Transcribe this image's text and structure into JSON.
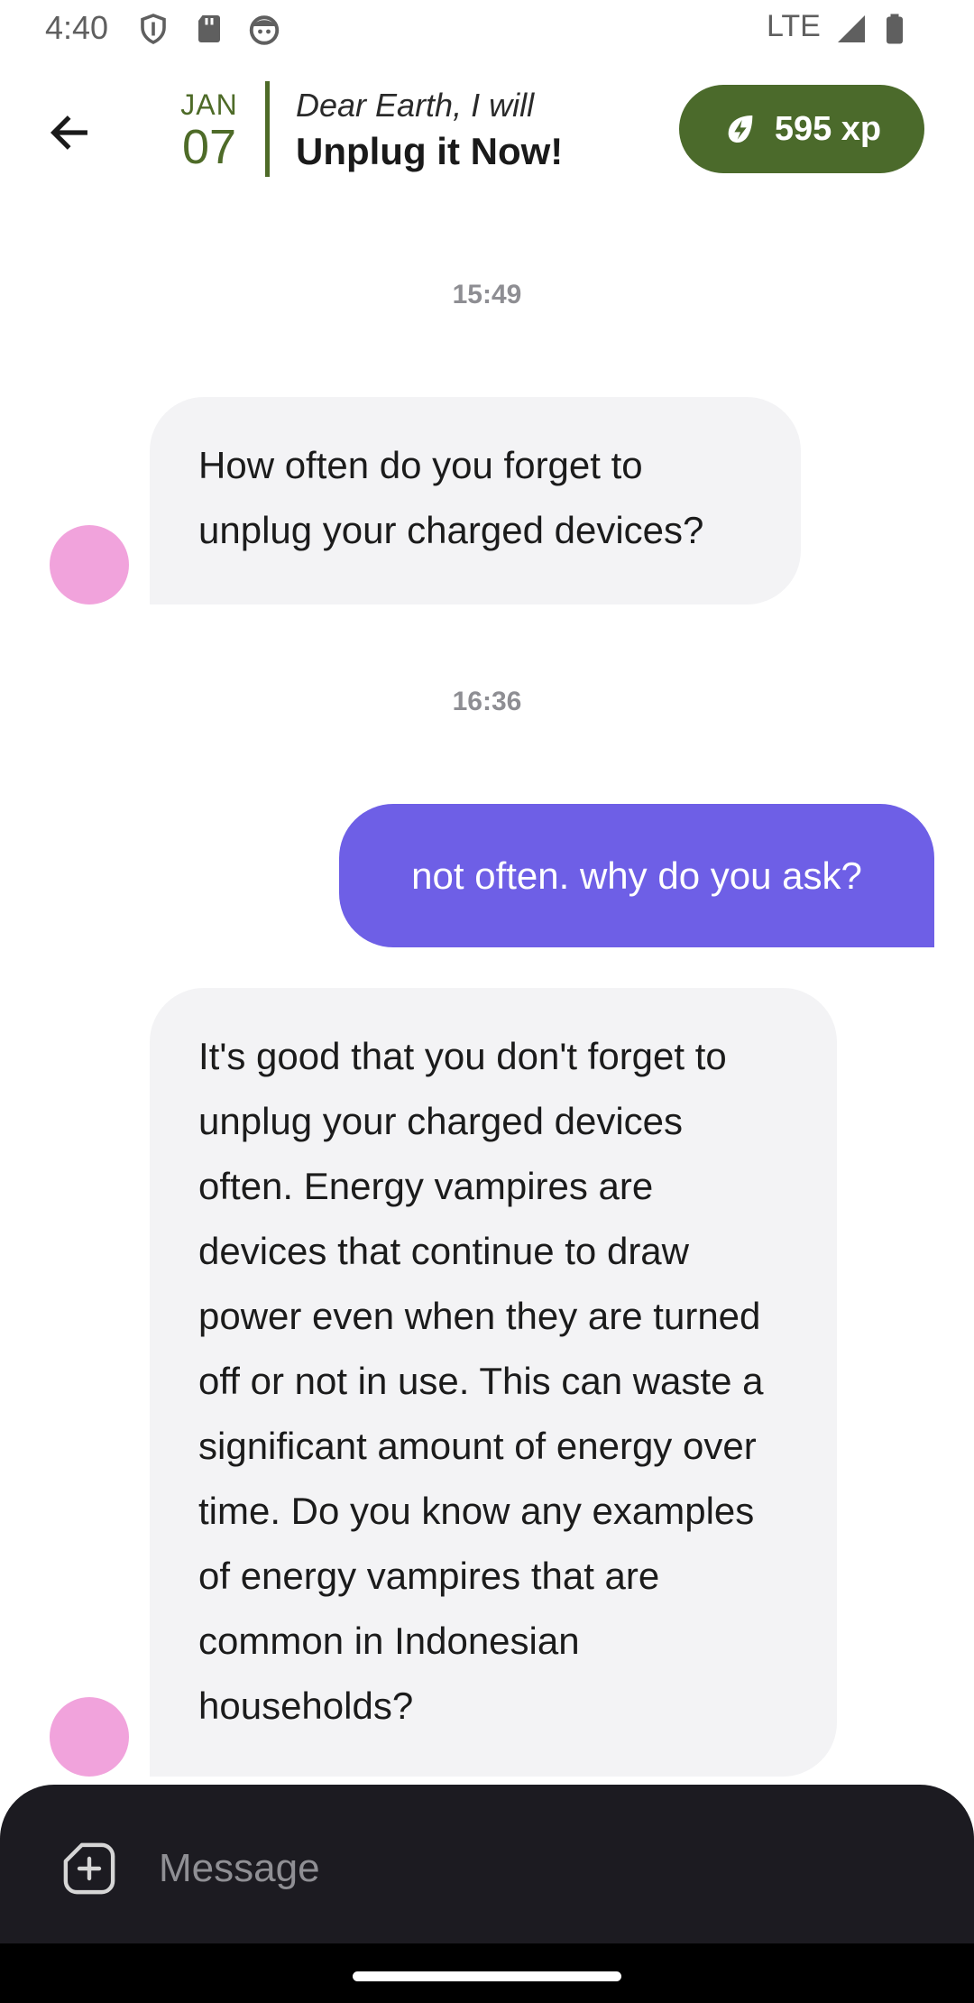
{
  "status_bar": {
    "time": "4:40",
    "network": "LTE",
    "icons": [
      "shield-icon",
      "sd-card-icon",
      "android-face-icon",
      "signal-icon",
      "battery-icon"
    ]
  },
  "header": {
    "back_icon": "arrow-left-icon",
    "date_month": "JAN",
    "date_day": "07",
    "title_pre": "Dear Earth, I will",
    "title_main": "Unplug it Now!",
    "xp_icon": "leaf-bolt-icon",
    "xp_label": "595 xp"
  },
  "chat": {
    "timestamp_1": "15:49",
    "message_1": "How often do you forget to unplug your charged devices?",
    "timestamp_2": "16:36",
    "message_2": "not often. why do you ask?",
    "message_3": "It's good that you don't forget to unplug your charged devices often. Energy vampires are devices that continue to draw power even when they are turned off or not in use. This can waste a significant amount of energy over time. Do you know any examples of energy vampires that are common in Indonesian households?"
  },
  "composer": {
    "attach_icon": "add-attachment-icon",
    "placeholder": "Message"
  },
  "colors": {
    "accent_green": "#4b6a2b",
    "user_bubble": "#6e5fe6",
    "bot_bubble": "#f3f3f5",
    "avatar": "#f1a3dc",
    "composer_bg": "#1c1b21"
  }
}
